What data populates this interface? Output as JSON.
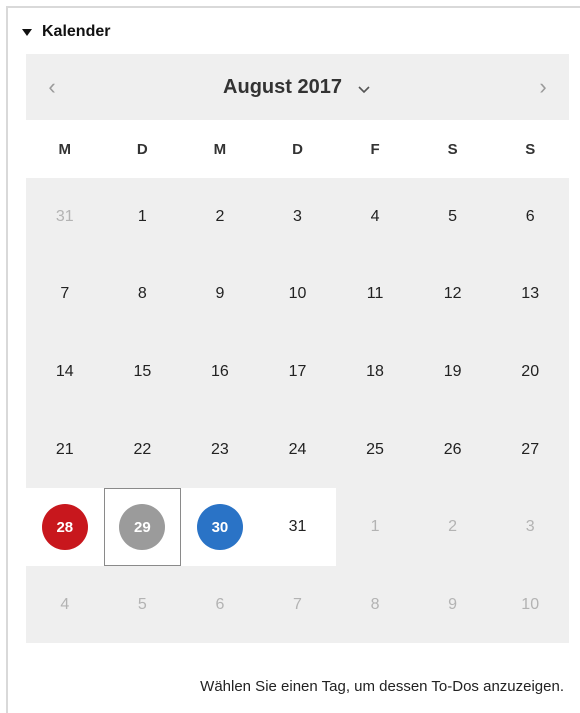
{
  "section": {
    "title": "Kalender"
  },
  "calendar": {
    "month_label": "August 2017",
    "prev_symbol": "‹",
    "next_symbol": "›",
    "weekdays": [
      "M",
      "D",
      "M",
      "D",
      "F",
      "S",
      "S"
    ],
    "colors": {
      "red": "#c8171d",
      "gray": "#9b9b9b",
      "blue": "#2a73c6"
    },
    "days": [
      {
        "d": "31",
        "other": true
      },
      {
        "d": "1"
      },
      {
        "d": "2"
      },
      {
        "d": "3"
      },
      {
        "d": "4"
      },
      {
        "d": "5"
      },
      {
        "d": "6"
      },
      {
        "d": "7"
      },
      {
        "d": "8"
      },
      {
        "d": "9"
      },
      {
        "d": "10"
      },
      {
        "d": "11"
      },
      {
        "d": "12"
      },
      {
        "d": "13"
      },
      {
        "d": "14"
      },
      {
        "d": "15"
      },
      {
        "d": "16"
      },
      {
        "d": "17"
      },
      {
        "d": "18"
      },
      {
        "d": "19"
      },
      {
        "d": "20"
      },
      {
        "d": "21"
      },
      {
        "d": "22"
      },
      {
        "d": "23"
      },
      {
        "d": "24"
      },
      {
        "d": "25"
      },
      {
        "d": "26"
      },
      {
        "d": "27"
      },
      {
        "d": "28",
        "circle": "red",
        "white": true
      },
      {
        "d": "29",
        "circle": "gray",
        "white": true,
        "outlined": true,
        "selected": true
      },
      {
        "d": "30",
        "circle": "blue",
        "white": true
      },
      {
        "d": "31",
        "white": true
      },
      {
        "d": "1",
        "other": true
      },
      {
        "d": "2",
        "other": true
      },
      {
        "d": "3",
        "other": true
      },
      {
        "d": "4",
        "other": true
      },
      {
        "d": "5",
        "other": true
      },
      {
        "d": "6",
        "other": true
      },
      {
        "d": "7",
        "other": true
      },
      {
        "d": "8",
        "other": true
      },
      {
        "d": "9",
        "other": true
      },
      {
        "d": "10",
        "other": true
      }
    ]
  },
  "hint": "Wählen Sie einen Tag, um dessen To-Dos anzuzeigen."
}
